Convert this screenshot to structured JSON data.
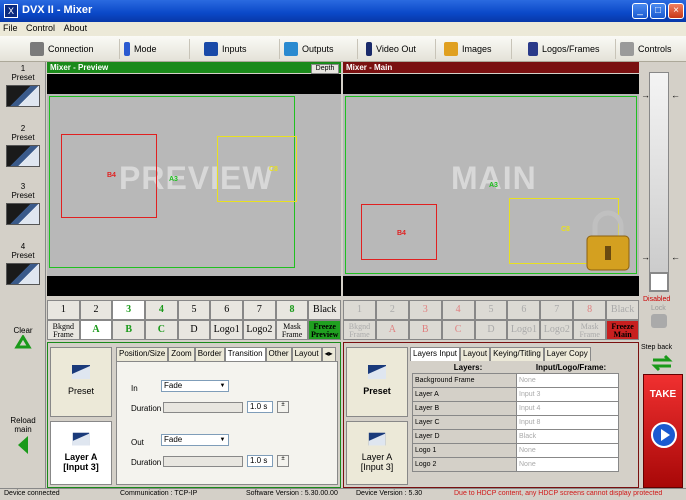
{
  "window": {
    "title": "DVX II - Mixer",
    "icon_text": "X"
  },
  "menu": [
    "File",
    "Control",
    "About"
  ],
  "toolbar": {
    "connection": "Connection",
    "mode": "Mode",
    "inputs": "Inputs",
    "outputs": "Outputs",
    "video_out": "Video Out",
    "images": "Images",
    "logos_frames": "Logos/Frames",
    "controls": "Controls"
  },
  "presets": [
    {
      "num": "1",
      "label": "Preset"
    },
    {
      "num": "2",
      "label": "Preset"
    },
    {
      "num": "3",
      "label": "Preset"
    },
    {
      "num": "4",
      "label": "Preset"
    }
  ],
  "left": {
    "clear": "Clear",
    "reload_1": "Reload",
    "reload_2": "main"
  },
  "preview": {
    "title": "Mixer - Preview",
    "depth": "Depth",
    "watermark": "PREVIEW",
    "b4": "B4",
    "a3": "A3",
    "c8": "C8"
  },
  "main": {
    "title": "Mixer - Main",
    "watermark": "MAIN",
    "b4": "B4",
    "a3": "A3",
    "c8": "C8"
  },
  "preview_nums": [
    "1",
    "2",
    "3",
    "4",
    "5",
    "6",
    "7",
    "8",
    "Black"
  ],
  "main_nums": [
    "1",
    "2",
    "3",
    "4",
    "5",
    "6",
    "7",
    "8",
    "Black"
  ],
  "preview_layers": {
    "bkgnd_1": "Bkgnd",
    "bkgnd_2": "Frame",
    "a": "A",
    "b": "B",
    "c": "C",
    "d": "D",
    "logo1": "Logo1",
    "logo2": "Logo2",
    "mask_1": "Mask",
    "mask_2": "Frame",
    "freeze_1": "Freeze",
    "freeze_2": "Preview"
  },
  "main_layers": {
    "bkgnd_1": "Bkgnd",
    "bkgnd_2": "Frame",
    "a": "A",
    "b": "B",
    "c": "C",
    "d": "D",
    "logo1": "Logo1",
    "logo2": "Logo2",
    "mask_1": "Mask",
    "mask_2": "Frame",
    "freeze_1": "Freeze",
    "freeze_2": "Main"
  },
  "right": {
    "disabled": "Disabled",
    "lock": "Lock",
    "step_back": "Step back",
    "take": "TAKE"
  },
  "preview_bottom": {
    "preset": "Preset",
    "layer_1": "Layer A",
    "layer_2": "[Input 3]",
    "tabs": [
      "Position/Size",
      "Zoom",
      "Border",
      "Transition",
      "Other",
      "Layout"
    ],
    "in_label": "In",
    "in_value": "Fade",
    "out_label": "Out",
    "out_value": "Fade",
    "duration_label": "Duration",
    "duration_in": "1.0 s",
    "duration_out": "1.0 s"
  },
  "main_bottom": {
    "preset": "Preset",
    "layer_1": "Layer A",
    "layer_2": "[Input 3]",
    "tabs": [
      "Layers Input",
      "Layout",
      "Keying/Titling",
      "Layer Copy"
    ],
    "col_layers": "Layers:",
    "col_input": "Input/Logo/Frame:",
    "rows": [
      {
        "name": "Background Frame",
        "value": "None"
      },
      {
        "name": "Layer A",
        "value": "Input 3"
      },
      {
        "name": "Layer B",
        "value": "Input 4"
      },
      {
        "name": "Layer C",
        "value": "Input 8"
      },
      {
        "name": "Layer D",
        "value": "Black"
      },
      {
        "name": "Logo 1",
        "value": "None"
      },
      {
        "name": "Logo 2",
        "value": "None"
      }
    ]
  },
  "status": {
    "conn": "Device connected",
    "comm": "Communication : TCP-IP",
    "sw": "Software Version : 5.30.00.00",
    "dev": "Device Version : 5.30",
    "hdcp": "Due to HDCP content, any HDCP screens cannot display protected"
  },
  "colors": {
    "title_blue": "#0a48c8",
    "preview_green": "#1a8a1a",
    "main_red": "#7a1010",
    "take_red": "#d01818",
    "box_red": "#e02020",
    "box_yellow": "#e8e020",
    "box_green": "#20c020"
  }
}
